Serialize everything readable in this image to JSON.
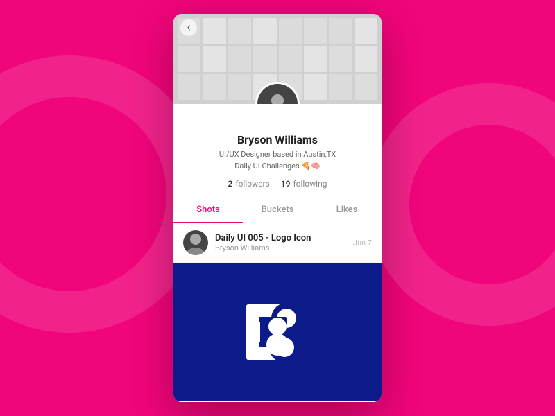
{
  "background": {
    "color": "#f0057a"
  },
  "profile": {
    "name": "Bryson Williams",
    "bio_line1": "UI/UX Designer based in Austin,TX",
    "bio_line2": "Daily UI Challenges 🍕🧠",
    "followers_count": "2",
    "followers_label": "followers",
    "following_count": "19",
    "following_label": "following"
  },
  "tabs": [
    {
      "id": "shots",
      "label": "Shots",
      "active": true
    },
    {
      "id": "buckets",
      "label": "Buckets",
      "active": false
    },
    {
      "id": "likes",
      "label": "Likes",
      "active": false
    }
  ],
  "shot": {
    "title": "Daily UI 005 - Logo Icon",
    "author": "Bryson Williams",
    "date": "Jun 7"
  },
  "nav": {
    "back_icon": "‹"
  }
}
